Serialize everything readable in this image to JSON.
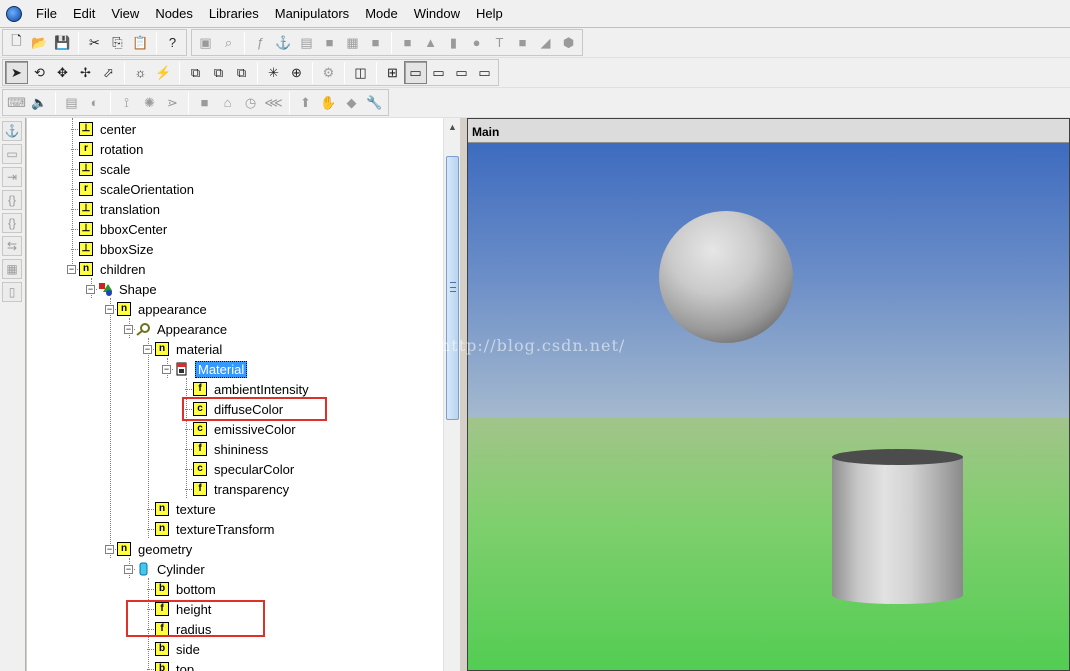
{
  "menu": [
    "File",
    "Edit",
    "View",
    "Nodes",
    "Libraries",
    "Manipulators",
    "Mode",
    "Window",
    "Help"
  ],
  "viewport": {
    "title": "Main"
  },
  "watermark": "http://blog.csdn.net/",
  "tree": [
    {
      "label": "center",
      "icon": "field-vec3-icon",
      "glyph": "⊥"
    },
    {
      "label": "rotation",
      "icon": "field-rotation-icon",
      "glyph": "r"
    },
    {
      "label": "scale",
      "icon": "field-vec3-icon",
      "glyph": "⊥"
    },
    {
      "label": "scaleOrientation",
      "icon": "field-rotation-icon",
      "glyph": "r"
    },
    {
      "label": "translation",
      "icon": "field-vec3-icon",
      "glyph": "⊥"
    },
    {
      "label": "bboxCenter",
      "icon": "field-vec3-icon",
      "glyph": "⊥"
    },
    {
      "label": "bboxSize",
      "icon": "field-vec3-icon",
      "glyph": "⊥"
    },
    {
      "label": "children",
      "icon": "field-node-list-icon",
      "glyph": "n"
    },
    {
      "label": "Shape",
      "icon": "shape-node-icon",
      "glyph": ""
    },
    {
      "label": "appearance",
      "icon": "field-node-icon",
      "glyph": "n"
    },
    {
      "label": "Appearance",
      "icon": "appearance-node-icon",
      "glyph": ""
    },
    {
      "label": "material",
      "icon": "field-node-icon",
      "glyph": "n"
    },
    {
      "label": "Material",
      "icon": "material-node-icon",
      "glyph": ""
    },
    {
      "label": "ambientIntensity",
      "icon": "field-float-icon",
      "glyph": "f"
    },
    {
      "label": "diffuseColor",
      "icon": "field-color-icon",
      "glyph": "c"
    },
    {
      "label": "emissiveColor",
      "icon": "field-color-icon",
      "glyph": "c"
    },
    {
      "label": "shininess",
      "icon": "field-float-icon",
      "glyph": "f"
    },
    {
      "label": "specularColor",
      "icon": "field-color-icon",
      "glyph": "c"
    },
    {
      "label": "transparency",
      "icon": "field-float-icon",
      "glyph": "f"
    },
    {
      "label": "texture",
      "icon": "field-node-icon",
      "glyph": "n"
    },
    {
      "label": "textureTransform",
      "icon": "field-node-icon",
      "glyph": "n"
    },
    {
      "label": "geometry",
      "icon": "field-node-icon",
      "glyph": "n"
    },
    {
      "label": "Cylinder",
      "icon": "cylinder-node-icon",
      "glyph": ""
    },
    {
      "label": "bottom",
      "icon": "field-bool-icon",
      "glyph": "b"
    },
    {
      "label": "height",
      "icon": "field-float-icon",
      "glyph": "f"
    },
    {
      "label": "radius",
      "icon": "field-float-icon",
      "glyph": "f"
    },
    {
      "label": "side",
      "icon": "field-bool-icon",
      "glyph": "b"
    },
    {
      "label": "top",
      "icon": "field-bool-icon",
      "glyph": "b"
    }
  ],
  "selected_label": "Material",
  "highlighted": [
    "diffuseColor",
    "height",
    "radius"
  ],
  "colors": {
    "highlight_box": "#e0302a",
    "selection": "#3399ff",
    "field_icon_bg": "#ffff40"
  }
}
